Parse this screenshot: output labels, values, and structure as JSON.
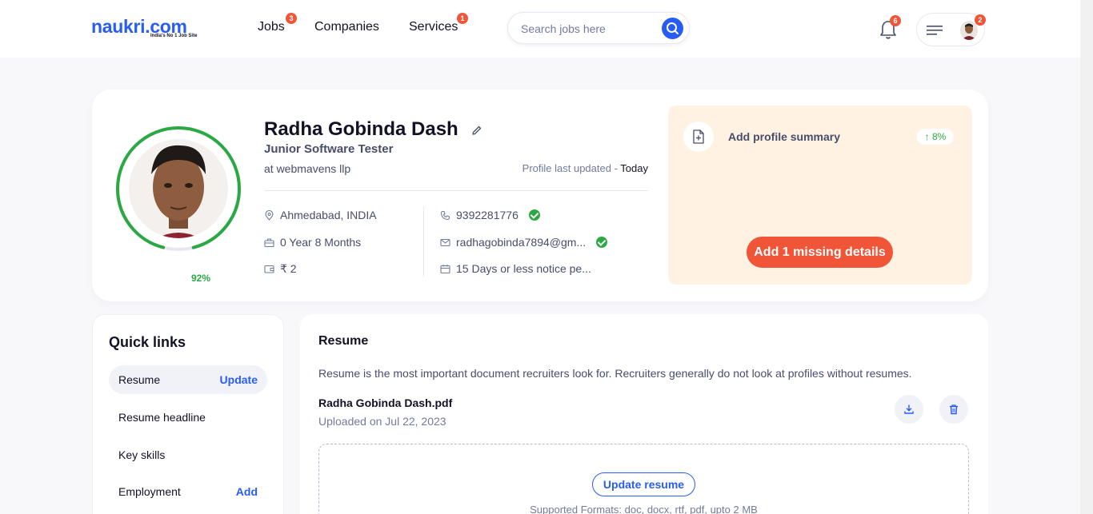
{
  "header": {
    "logo_text": "naukri.com",
    "logo_tagline": "India's No 1 Job Site",
    "nav": [
      {
        "label": "Jobs",
        "badge": "3"
      },
      {
        "label": "Companies",
        "badge": ""
      },
      {
        "label": "Services",
        "badge": "1"
      }
    ],
    "search_placeholder": "Search jobs here",
    "notification_count": "6",
    "profile_badge": "2"
  },
  "profile": {
    "name": "Radha Gobinda Dash",
    "designation": "Junior Software Tester",
    "company": "at webmavens llp",
    "completion": "92%",
    "completion_fraction": 0.92,
    "last_updated_label": "Profile last updated",
    "last_updated_value": "Today",
    "location": "Ahmedabad, INDIA",
    "experience": "0 Year 8 Months",
    "salary": "₹ 2",
    "phone": "9392281776",
    "email": "radhagobinda7894@gm...",
    "notice": "15 Days or less notice pe..."
  },
  "summary_box": {
    "label": "Add profile summary",
    "gain": "8%",
    "button": "Add 1 missing details"
  },
  "quick_links": {
    "title": "Quick links",
    "items": [
      {
        "label": "Resume",
        "action": "Update"
      },
      {
        "label": "Resume headline",
        "action": ""
      },
      {
        "label": "Key skills",
        "action": ""
      },
      {
        "label": "Employment",
        "action": "Add"
      }
    ]
  },
  "resume": {
    "title": "Resume",
    "description": "Resume is the most important document recruiters look for. Recruiters generally do not look at profiles without resumes.",
    "file_name": "Radha Gobinda Dash.pdf",
    "uploaded": "Uploaded on Jul 22, 2023",
    "update_button": "Update resume",
    "formats": "Supported Formats: doc, docx, rtf, pdf, upto 2 MB"
  },
  "colors": {
    "brand_blue": "#275df5",
    "accent_orange": "#f05537",
    "success_green": "#2aa843",
    "summary_bg": "#fff2e3"
  }
}
